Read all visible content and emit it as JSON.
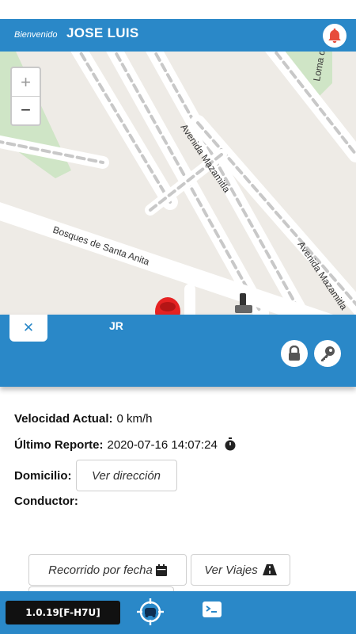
{
  "header": {
    "welcome": "Bienvenido",
    "user_name": "JOSE LUIS",
    "alarm_icon": "bell-icon",
    "accent_color": "#2a88c8"
  },
  "map": {
    "zoom_in": "+",
    "zoom_out": "−",
    "streets": {
      "avenida_mazamitla_1": "Avenida Mazamitla",
      "avenida_mazamitla_2": "Avenida Mazamitla",
      "bosques": "Bosques de Santa Anita",
      "loma": "Loma d"
    }
  },
  "panel": {
    "close_label": "✕",
    "vehicle_name": "JR",
    "lock_icon": "lock-icon",
    "key_icon": "key-icon"
  },
  "details": {
    "speed_label": "Velocidad Actual:",
    "speed_value": "0 km/h",
    "report_label": "Último Reporte:",
    "report_value": "2020-07-16 14:07:24",
    "address_label": "Domicilio:",
    "address_button": "Ver dirección",
    "driver_label": "Conductor:",
    "driver_value": ""
  },
  "actions": {
    "route_by_date": "Recorrido por fecha",
    "view_trips": "Ver Viajes"
  },
  "bottom_bar": {
    "version": "1.0.19[F-H7U]",
    "locate_icon": "locate-car-icon",
    "terminal_icon": "terminal-icon"
  }
}
